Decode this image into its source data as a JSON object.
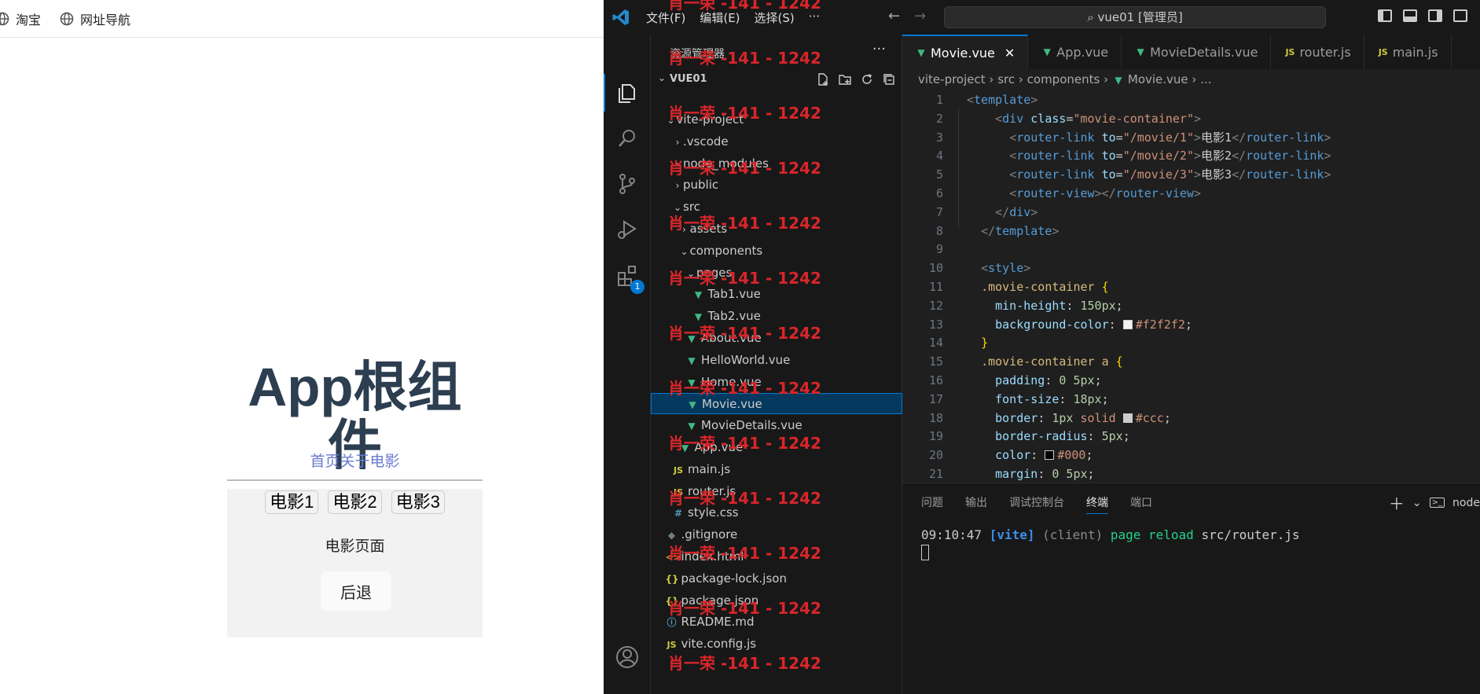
{
  "browser": {
    "bookmarks": [
      "淘宝",
      "网址导航"
    ],
    "app_title": "App根组件",
    "nav_links": [
      "首页",
      "关于",
      "电影"
    ],
    "movie_links": [
      "电影1",
      "电影2",
      "电影3"
    ],
    "movie_page_text": "电影页面",
    "back_button": "后退"
  },
  "vscode": {
    "menus": [
      "文件(F)",
      "编辑(E)",
      "选择(S)",
      "···"
    ],
    "command_center": "vue01 [管理员]",
    "sidebar_title": "资源管理器",
    "sidebar_more": "···",
    "folder_name": "VUE01",
    "extensions_badge": "1",
    "tree": [
      {
        "name": "vite-project",
        "chevron": "⌄",
        "type": "folder"
      },
      {
        "name": ".vscode",
        "chevron": "›",
        "type": "folder"
      },
      {
        "name": "node_modules",
        "chevron": "›",
        "type": "folder"
      },
      {
        "name": "public",
        "chevron": "›",
        "type": "folder"
      },
      {
        "name": "src",
        "chevron": "⌄",
        "type": "folder"
      },
      {
        "name": "assets",
        "chevron": "›",
        "type": "folder"
      },
      {
        "name": "components",
        "chevron": "⌄",
        "type": "folder"
      },
      {
        "name": "pages",
        "chevron": "⌄",
        "type": "folder"
      },
      {
        "name": "Tab1.vue",
        "type": "vue"
      },
      {
        "name": "Tab2.vue",
        "type": "vue"
      },
      {
        "name": "About.vue",
        "type": "vue"
      },
      {
        "name": "HelloWorld.vue",
        "type": "vue"
      },
      {
        "name": "Home.vue",
        "type": "vue"
      },
      {
        "name": "Movie.vue",
        "type": "vue",
        "selected": true
      },
      {
        "name": "MovieDetails.vue",
        "type": "vue"
      },
      {
        "name": "App.vue",
        "type": "vue"
      },
      {
        "name": "main.js",
        "type": "js"
      },
      {
        "name": "router.js",
        "type": "js"
      },
      {
        "name": "style.css",
        "type": "css"
      },
      {
        "name": ".gitignore",
        "type": "git"
      },
      {
        "name": "index.html",
        "type": "html"
      },
      {
        "name": "package-lock.json",
        "type": "json"
      },
      {
        "name": "package.json",
        "type": "json"
      },
      {
        "name": "README.md",
        "type": "info"
      },
      {
        "name": "vite.config.js",
        "type": "js"
      }
    ],
    "watermark": "肖一荣 -141 - 1242",
    "tabs": [
      {
        "label": "Movie.vue",
        "type": "vue",
        "active": true
      },
      {
        "label": "App.vue",
        "type": "vue"
      },
      {
        "label": "MovieDetails.vue",
        "type": "vue"
      },
      {
        "label": "router.js",
        "type": "js"
      },
      {
        "label": "main.js",
        "type": "js"
      }
    ],
    "breadcrumb": [
      "vite-project",
      "src",
      "components",
      "Movie.vue",
      "..."
    ],
    "code_lines": [
      [
        [
          "t-punc",
          "<"
        ],
        [
          "t-tag",
          "template"
        ],
        [
          "t-punc",
          ">"
        ]
      ],
      [
        [
          "t-text",
          "    "
        ],
        [
          "t-punc",
          "<"
        ],
        [
          "t-tag",
          "div"
        ],
        [
          "t-text",
          " "
        ],
        [
          "t-attr",
          "class"
        ],
        [
          "t-text",
          "="
        ],
        [
          "t-str",
          "\"movie-container\""
        ],
        [
          "t-punc",
          ">"
        ]
      ],
      [
        [
          "t-text",
          "      "
        ],
        [
          "t-punc",
          "<"
        ],
        [
          "t-tag",
          "router-link"
        ],
        [
          "t-text",
          " "
        ],
        [
          "t-attr",
          "to"
        ],
        [
          "t-text",
          "="
        ],
        [
          "t-str",
          "\"/movie/1\""
        ],
        [
          "t-punc",
          ">"
        ],
        [
          "t-text",
          "电影1"
        ],
        [
          "t-punc",
          "</"
        ],
        [
          "t-tag",
          "router-link"
        ],
        [
          "t-punc",
          ">"
        ]
      ],
      [
        [
          "t-text",
          "      "
        ],
        [
          "t-punc",
          "<"
        ],
        [
          "t-tag",
          "router-link"
        ],
        [
          "t-text",
          " "
        ],
        [
          "t-attr",
          "to"
        ],
        [
          "t-text",
          "="
        ],
        [
          "t-str",
          "\"/movie/2\""
        ],
        [
          "t-punc",
          ">"
        ],
        [
          "t-text",
          "电影2"
        ],
        [
          "t-punc",
          "</"
        ],
        [
          "t-tag",
          "router-link"
        ],
        [
          "t-punc",
          ">"
        ]
      ],
      [
        [
          "t-text",
          "      "
        ],
        [
          "t-punc",
          "<"
        ],
        [
          "t-tag",
          "router-link"
        ],
        [
          "t-text",
          " "
        ],
        [
          "t-attr",
          "to"
        ],
        [
          "t-text",
          "="
        ],
        [
          "t-str",
          "\"/movie/3\""
        ],
        [
          "t-punc",
          ">"
        ],
        [
          "t-text",
          "电影3"
        ],
        [
          "t-punc",
          "</"
        ],
        [
          "t-tag",
          "router-link"
        ],
        [
          "t-punc",
          ">"
        ]
      ],
      [
        [
          "t-text",
          "      "
        ],
        [
          "t-punc",
          "<"
        ],
        [
          "t-tag",
          "router-view"
        ],
        [
          "t-punc",
          "></"
        ],
        [
          "t-tag",
          "router-view"
        ],
        [
          "t-punc",
          ">"
        ]
      ],
      [
        [
          "t-text",
          "    "
        ],
        [
          "t-punc",
          "</"
        ],
        [
          "t-tag",
          "div"
        ],
        [
          "t-punc",
          ">"
        ]
      ],
      [
        [
          "t-text",
          "  "
        ],
        [
          "t-punc",
          "</"
        ],
        [
          "t-tag",
          "template"
        ],
        [
          "t-punc",
          ">"
        ]
      ],
      [],
      [
        [
          "t-text",
          "  "
        ],
        [
          "t-punc",
          "<"
        ],
        [
          "t-tag",
          "style"
        ],
        [
          "t-punc",
          ">"
        ]
      ],
      [
        [
          "t-text",
          "  "
        ],
        [
          "t-sel",
          ".movie-container"
        ],
        [
          "t-text",
          " "
        ],
        [
          "t-brace",
          "{"
        ]
      ],
      [
        [
          "t-text",
          "    "
        ],
        [
          "t-prop",
          "min-height"
        ],
        [
          "t-text",
          ": "
        ],
        [
          "t-num",
          "150px"
        ],
        [
          "t-text",
          ";"
        ]
      ],
      [
        [
          "t-text",
          "    "
        ],
        [
          "t-prop",
          "background-color"
        ],
        [
          "t-text",
          ": "
        ],
        [
          "swatch",
          "#f2f2f2"
        ],
        [
          "t-val",
          "#f2f2f2"
        ],
        [
          "t-text",
          ";"
        ]
      ],
      [
        [
          "t-text",
          "  "
        ],
        [
          "t-brace",
          "}"
        ]
      ],
      [
        [
          "t-text",
          "  "
        ],
        [
          "t-sel",
          ".movie-container a"
        ],
        [
          "t-text",
          " "
        ],
        [
          "t-brace",
          "{"
        ]
      ],
      [
        [
          "t-text",
          "    "
        ],
        [
          "t-prop",
          "padding"
        ],
        [
          "t-text",
          ": "
        ],
        [
          "t-num",
          "0 5px"
        ],
        [
          "t-text",
          ";"
        ]
      ],
      [
        [
          "t-text",
          "    "
        ],
        [
          "t-prop",
          "font-size"
        ],
        [
          "t-text",
          ": "
        ],
        [
          "t-num",
          "18px"
        ],
        [
          "t-text",
          ";"
        ]
      ],
      [
        [
          "t-text",
          "    "
        ],
        [
          "t-prop",
          "border"
        ],
        [
          "t-text",
          ": "
        ],
        [
          "t-num",
          "1px"
        ],
        [
          "t-text",
          " "
        ],
        [
          "t-val",
          "solid"
        ],
        [
          "t-text",
          " "
        ],
        [
          "swatch",
          "#ccc"
        ],
        [
          "t-val",
          "#ccc"
        ],
        [
          "t-text",
          ";"
        ]
      ],
      [
        [
          "t-text",
          "    "
        ],
        [
          "t-prop",
          "border-radius"
        ],
        [
          "t-text",
          ": "
        ],
        [
          "t-num",
          "5px"
        ],
        [
          "t-text",
          ";"
        ]
      ],
      [
        [
          "t-text",
          "    "
        ],
        [
          "t-prop",
          "color"
        ],
        [
          "t-text",
          ": "
        ],
        [
          "swatch",
          "#000"
        ],
        [
          "t-val",
          "#000"
        ],
        [
          "t-text",
          ";"
        ]
      ],
      [
        [
          "t-text",
          "    "
        ],
        [
          "t-prop",
          "margin"
        ],
        [
          "t-text",
          ": "
        ],
        [
          "t-num",
          "0 5px"
        ],
        [
          "t-text",
          ";"
        ]
      ]
    ],
    "panel_tabs": [
      "问题",
      "输出",
      "调试控制台",
      "终端",
      "端口"
    ],
    "panel_active": "终端",
    "terminal_profile": "node",
    "terminal": {
      "time": "09:10:47",
      "tag": "[vite]",
      "client": "(client)",
      "action": "page reload",
      "file": "src/router.js"
    }
  }
}
